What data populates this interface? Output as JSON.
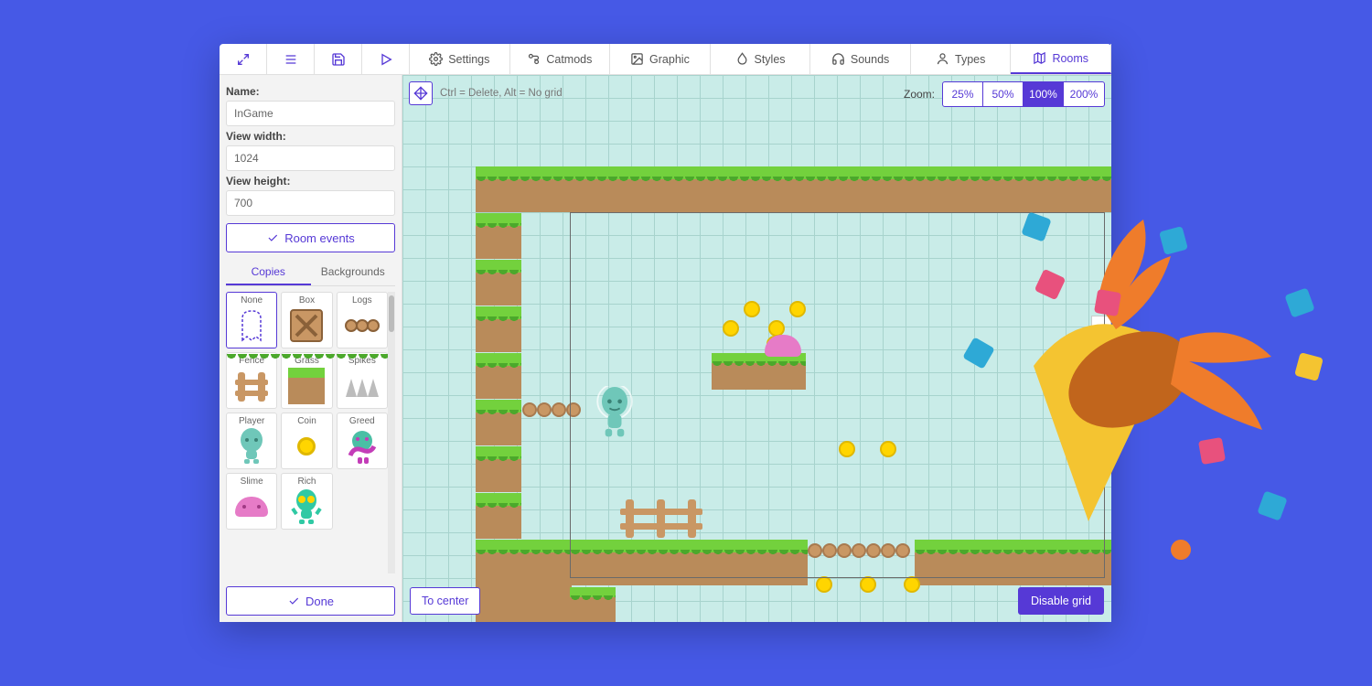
{
  "topbar": {
    "tabs": [
      {
        "id": "settings",
        "label": "Settings",
        "icon": "gear-icon"
      },
      {
        "id": "catmods",
        "label": "Catmods",
        "icon": "module-icon"
      },
      {
        "id": "graphic",
        "label": "Graphic",
        "icon": "image-icon"
      },
      {
        "id": "styles",
        "label": "Styles",
        "icon": "droplet-icon"
      },
      {
        "id": "sounds",
        "label": "Sounds",
        "icon": "headphones-icon"
      },
      {
        "id": "types",
        "label": "Types",
        "icon": "person-icon"
      },
      {
        "id": "rooms",
        "label": "Rooms",
        "icon": "map-icon",
        "active": true
      }
    ]
  },
  "sidebar": {
    "name_label": "Name:",
    "name_value": "InGame",
    "view_width_label": "View width:",
    "view_width_value": "1024",
    "view_height_label": "View height:",
    "view_height_value": "700",
    "room_events_label": "Room events",
    "subtabs": {
      "copies": "Copies",
      "backgrounds": "Backgrounds",
      "active": "copies"
    },
    "palette": [
      {
        "name": "None"
      },
      {
        "name": "Box"
      },
      {
        "name": "Logs"
      },
      {
        "name": "Fence"
      },
      {
        "name": "Grass"
      },
      {
        "name": "Spikes"
      },
      {
        "name": "Player"
      },
      {
        "name": "Coin"
      },
      {
        "name": "Greed"
      },
      {
        "name": "Slime"
      },
      {
        "name": "Rich"
      }
    ],
    "done_label": "Done"
  },
  "canvas": {
    "hint": "Ctrl = Delete, Alt = No grid",
    "zoom_label": "Zoom:",
    "zoom_levels": [
      "25%",
      "50%",
      "100%",
      "200%"
    ],
    "zoom_active": "100%",
    "to_center_label": "To center",
    "disable_grid_label": "Disable grid"
  },
  "colors": {
    "accent": "#5639d6",
    "grass": "#73d13d",
    "dirt": "#b98b5a",
    "coin": "#ffd500",
    "slime": "#e67bc7",
    "confetti_orange": "#ef7c2b",
    "confetti_yellow": "#f4c431",
    "confetti_blue": "#2ea9d6",
    "confetti_pink": "#e8517d"
  }
}
